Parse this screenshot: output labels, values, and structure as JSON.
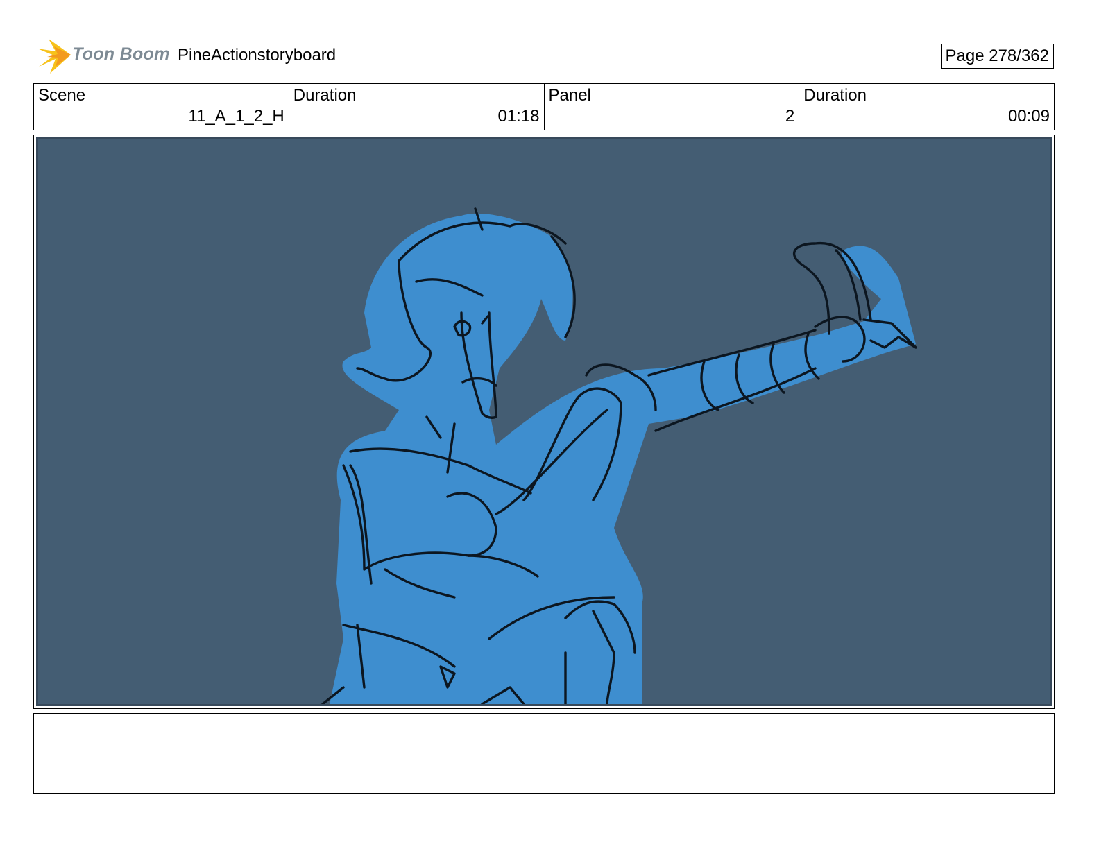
{
  "header": {
    "logo_text": "Toon Boom",
    "project_title": "PineActionstoryboard",
    "page_label": "Page 278/362"
  },
  "info": {
    "scene_label": "Scene",
    "scene_value": "11_A_1_2_H",
    "scene_duration_label": "Duration",
    "scene_duration_value": "01:18",
    "panel_label": "Panel",
    "panel_value": "2",
    "panel_duration_label": "Duration",
    "panel_duration_value": "00:09"
  },
  "colors": {
    "panel_background": "#445d73",
    "figure_fill": "#3e8ecf",
    "logo_accent": "#f7c21a"
  },
  "notes": {
    "text": ""
  }
}
